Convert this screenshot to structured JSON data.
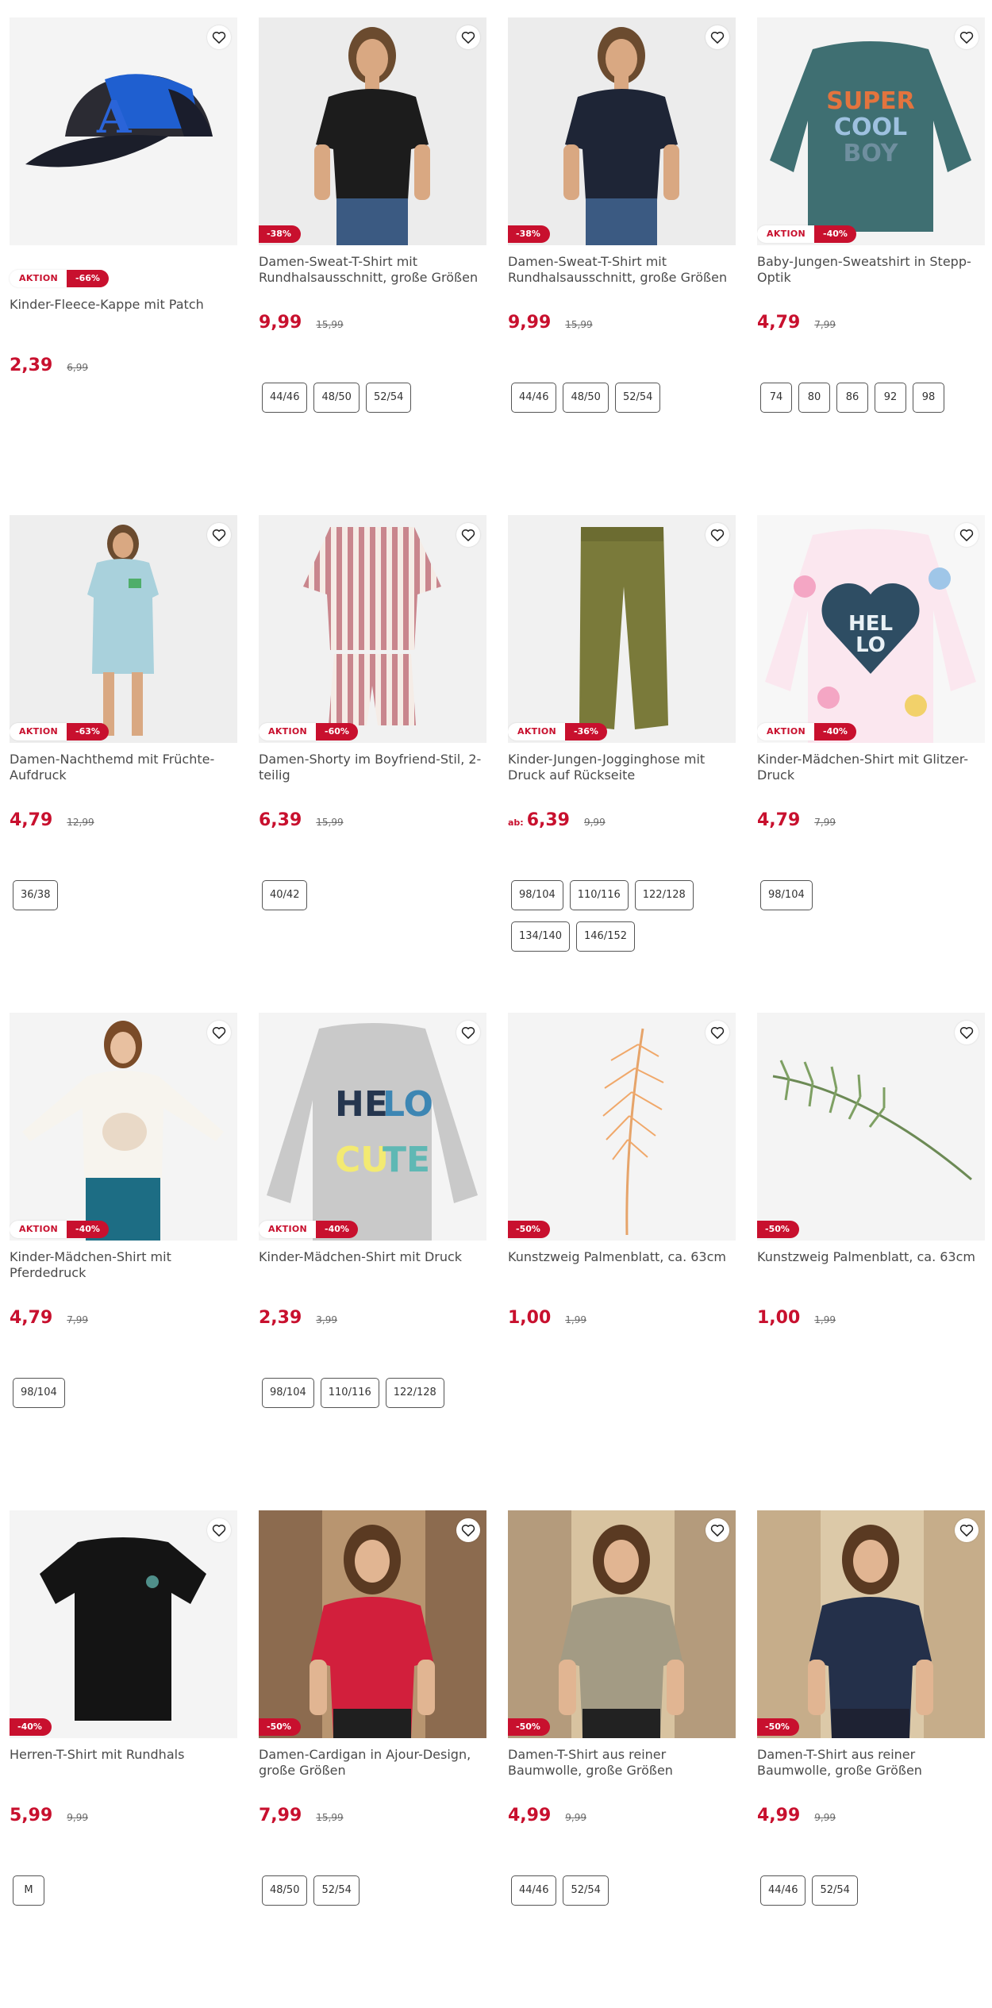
{
  "colors": {
    "accent": "#c8102e",
    "text": "#4a4a4a",
    "chip_border": "#555555"
  },
  "products": [
    {
      "title": "Kinder-Fleece-Kappe mit Patch",
      "aktion": "AKTION",
      "discount": "-66%",
      "price_prefix": "",
      "price": "2,39",
      "old_price": "6,99",
      "sizes": [],
      "image": "cap"
    },
    {
      "title": "Damen-Sweat-T-Shirt mit Rundhalsausschnitt, große Größen",
      "aktion": "",
      "discount": "-38%",
      "price_prefix": "",
      "price": "9,99",
      "old_price": "15,99",
      "sizes": [
        "44/46",
        "48/50",
        "52/54"
      ],
      "image": "woman-black-shirt"
    },
    {
      "title": "Damen-Sweat-T-Shirt mit Rundhalsausschnitt, große Größen",
      "aktion": "",
      "discount": "-38%",
      "price_prefix": "",
      "price": "9,99",
      "old_price": "15,99",
      "sizes": [
        "44/46",
        "48/50",
        "52/54"
      ],
      "image": "woman-navy-shirt"
    },
    {
      "title": "Baby-Jungen-Sweatshirt in Stepp-Optik",
      "aktion": "AKTION",
      "discount": "-40%",
      "price_prefix": "",
      "price": "4,79",
      "old_price": "7,99",
      "sizes": [
        "74",
        "80",
        "86",
        "92",
        "98"
      ],
      "image": "sweatshirt-super-cool-boy",
      "print_lines": [
        "SUPER",
        "COOL",
        "BOY"
      ]
    },
    {
      "title": "Damen-Nachthemd mit Früchte-Aufdruck",
      "aktion": "AKTION",
      "discount": "-63%",
      "price_prefix": "",
      "price": "4,79",
      "old_price": "12,99",
      "sizes": [
        "36/38"
      ],
      "image": "woman-nightdress"
    },
    {
      "title": "Damen-Shorty im Boyfriend-Stil, 2-teilig",
      "aktion": "AKTION",
      "discount": "-60%",
      "price_prefix": "",
      "price": "6,39",
      "old_price": "15,99",
      "sizes": [
        "40/42"
      ],
      "image": "striped-pyjama"
    },
    {
      "title": "Kinder-Jungen-Jogginghose mit Druck auf Rückseite",
      "aktion": "AKTION",
      "discount": "-36%",
      "price_prefix": "ab:",
      "price": "6,39",
      "old_price": "9,99",
      "sizes": [
        "98/104",
        "110/116",
        "122/128",
        "134/140",
        "146/152"
      ],
      "image": "olive-joggers"
    },
    {
      "title": "Kinder-Mädchen-Shirt mit Glitzer-Druck",
      "aktion": "AKTION",
      "discount": "-40%",
      "price_prefix": "",
      "price": "4,79",
      "old_price": "7,99",
      "sizes": [
        "98/104"
      ],
      "image": "floral-shirt-heart",
      "print_lines": [
        "HEL",
        "LO"
      ]
    },
    {
      "title": "Kinder-Mädchen-Shirt mit Pferdedruck",
      "aktion": "AKTION",
      "discount": "-40%",
      "price_prefix": "",
      "price": "4,79",
      "old_price": "7,99",
      "sizes": [
        "98/104"
      ],
      "image": "girl-horse-shirt"
    },
    {
      "title": "Kinder-Mädchen-Shirt mit Druck",
      "aktion": "AKTION",
      "discount": "-40%",
      "price_prefix": "",
      "price": "2,39",
      "old_price": "3,99",
      "sizes": [
        "98/104",
        "110/116",
        "122/128"
      ],
      "image": "grey-shirt-hello-cutie",
      "print_lines": [
        "HE",
        "LO",
        "CU",
        "TE"
      ]
    },
    {
      "title": "Kunstzweig Palmenblatt, ca. 63cm",
      "aktion": "",
      "discount": "-50%",
      "price_prefix": "",
      "price": "1,00",
      "old_price": "1,99",
      "sizes": [],
      "image": "palm-leaf-orange"
    },
    {
      "title": "Kunstzweig Palmenblatt, ca. 63cm",
      "aktion": "",
      "discount": "-50%",
      "price_prefix": "",
      "price": "1,00",
      "old_price": "1,99",
      "sizes": [],
      "image": "palm-leaf-green"
    },
    {
      "title": "Herren-T-Shirt mit Rundhals",
      "aktion": "",
      "discount": "-40%",
      "price_prefix": "",
      "price": "5,99",
      "old_price": "9,99",
      "sizes": [
        "M"
      ],
      "image": "black-tshirt"
    },
    {
      "title": "Damen-Cardigan in Ajour-Design, große Größen",
      "aktion": "",
      "discount": "-50%",
      "price_prefix": "",
      "price": "7,99",
      "old_price": "15,99",
      "sizes": [
        "48/50",
        "52/54"
      ],
      "image": "woman-cardigan"
    },
    {
      "title": "Damen-T-Shirt aus reiner Baumwolle, große Größen",
      "aktion": "",
      "discount": "-50%",
      "price_prefix": "",
      "price": "4,99",
      "old_price": "9,99",
      "sizes": [
        "44/46",
        "52/54"
      ],
      "image": "woman-khaki-tshirt"
    },
    {
      "title": "Damen-T-Shirt aus reiner Baumwolle, große Größen",
      "aktion": "",
      "discount": "-50%",
      "price_prefix": "",
      "price": "4,99",
      "old_price": "9,99",
      "sizes": [
        "44/46",
        "52/54"
      ],
      "image": "woman-navy-tshirt"
    }
  ]
}
